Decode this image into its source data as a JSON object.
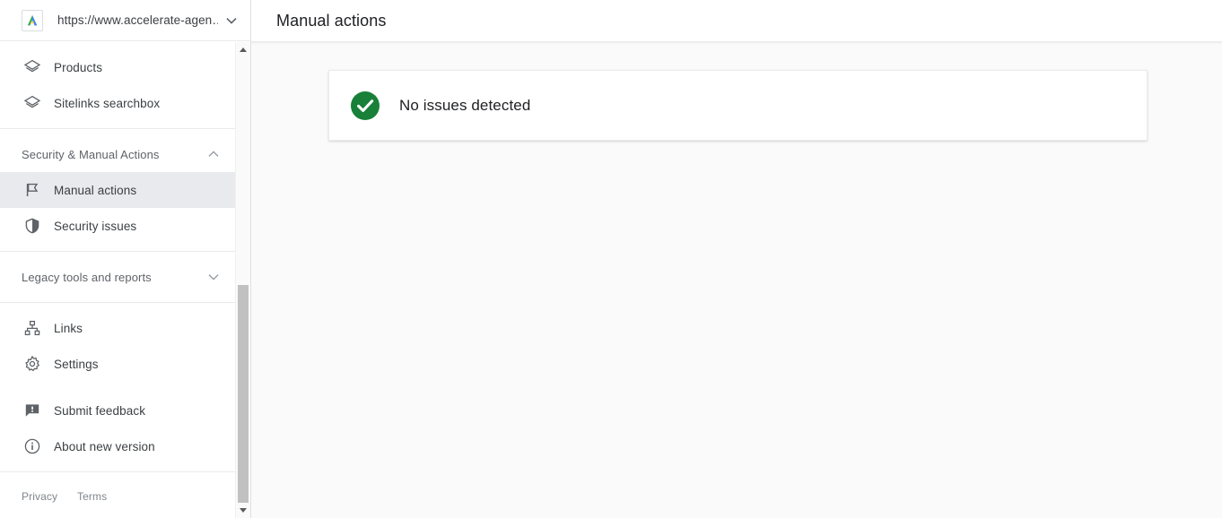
{
  "property": {
    "url": "https://www.accelerate-agen…",
    "logo_icon": "site-logo-icon",
    "caret_icon": "chevron-down-icon"
  },
  "sidebar": {
    "top_items": [
      {
        "label": "Products",
        "icon": "layers-icon",
        "selected": false
      },
      {
        "label": "Sitelinks searchbox",
        "icon": "layers-icon",
        "selected": false
      }
    ],
    "groups": [
      {
        "label": "Security & Manual Actions",
        "expanded": true,
        "chevron_icon": "chevron-up-icon",
        "items": [
          {
            "label": "Manual actions",
            "icon": "flag-icon",
            "selected": true
          },
          {
            "label": "Security issues",
            "icon": "shield-icon",
            "selected": false
          }
        ]
      },
      {
        "label": "Legacy tools and reports",
        "expanded": false,
        "chevron_icon": "chevron-down-icon",
        "items": []
      }
    ],
    "tools": [
      {
        "label": "Links",
        "icon": "account-tree-icon"
      },
      {
        "label": "Settings",
        "icon": "gear-icon"
      }
    ],
    "secondary": [
      {
        "label": "Submit feedback",
        "icon": "feedback-icon"
      },
      {
        "label": "About new version",
        "icon": "info-icon"
      }
    ],
    "footer": [
      {
        "label": "Privacy"
      },
      {
        "label": "Terms"
      }
    ],
    "scrollbar": {
      "up_arrow_icon": "scroll-up-arrow-icon",
      "down_arrow_icon": "scroll-down-arrow-icon"
    }
  },
  "header": {
    "title": "Manual actions"
  },
  "main": {
    "status": {
      "icon": "check-circle-icon",
      "text": "No issues detected",
      "color": "#188038"
    }
  },
  "colors": {
    "accent_green": "#188038",
    "selected_bg": "#e8eaed",
    "page_bg": "#fafafa",
    "text_primary": "#202124",
    "text_secondary": "#5f6368"
  }
}
